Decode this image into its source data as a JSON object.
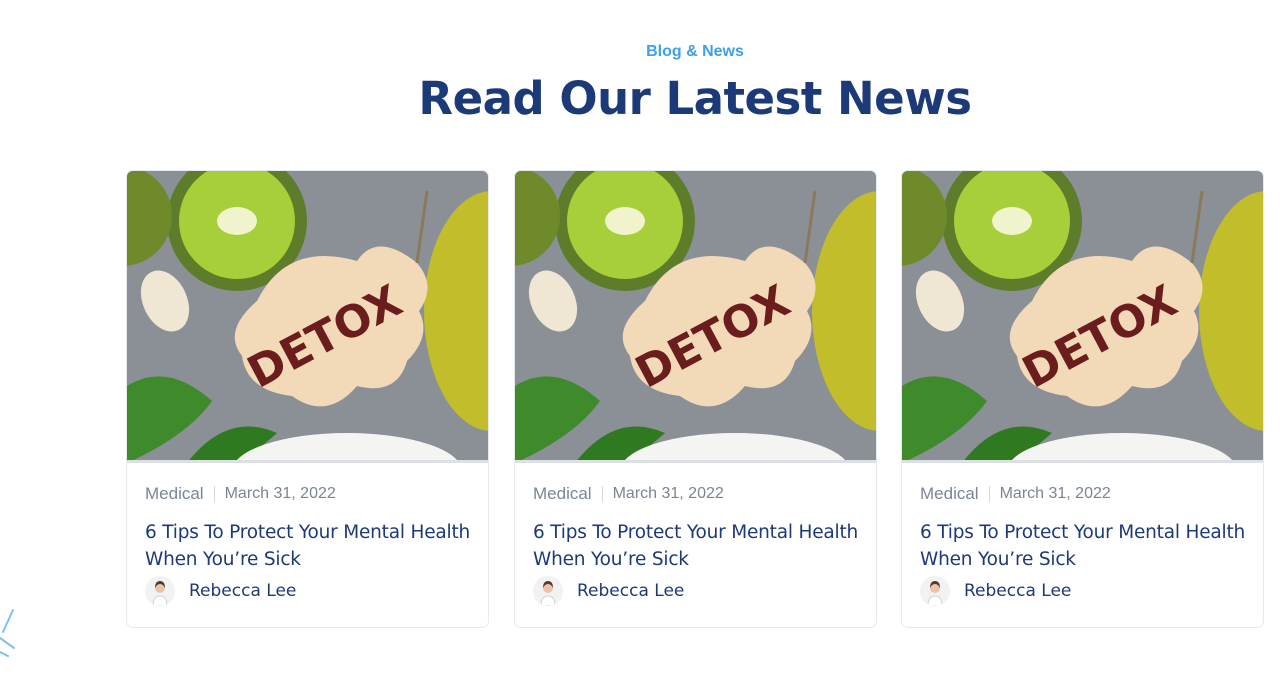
{
  "section": {
    "eyebrow": "Blog & News",
    "title": "Read Our Latest News"
  },
  "posts": [
    {
      "image_alt": "DETOX",
      "category": "Medical",
      "date": "March 31, 2022",
      "title": "6 Tips To Protect Your Mental Health When You’re Sick",
      "author": "Rebecca Lee"
    },
    {
      "image_alt": "DETOX",
      "category": "Medical",
      "date": "March 31, 2022",
      "title": "6 Tips To Protect Your Mental Health When You’re Sick",
      "author": "Rebecca Lee"
    },
    {
      "image_alt": "DETOX",
      "category": "Medical",
      "date": "March 31, 2022",
      "title": "6 Tips To Protect Your Mental Health When You’re Sick",
      "author": "Rebecca Lee"
    }
  ],
  "colors": {
    "accent": "#3aa0f0",
    "heading": "#1c3a78",
    "meta": "#7a8597"
  }
}
